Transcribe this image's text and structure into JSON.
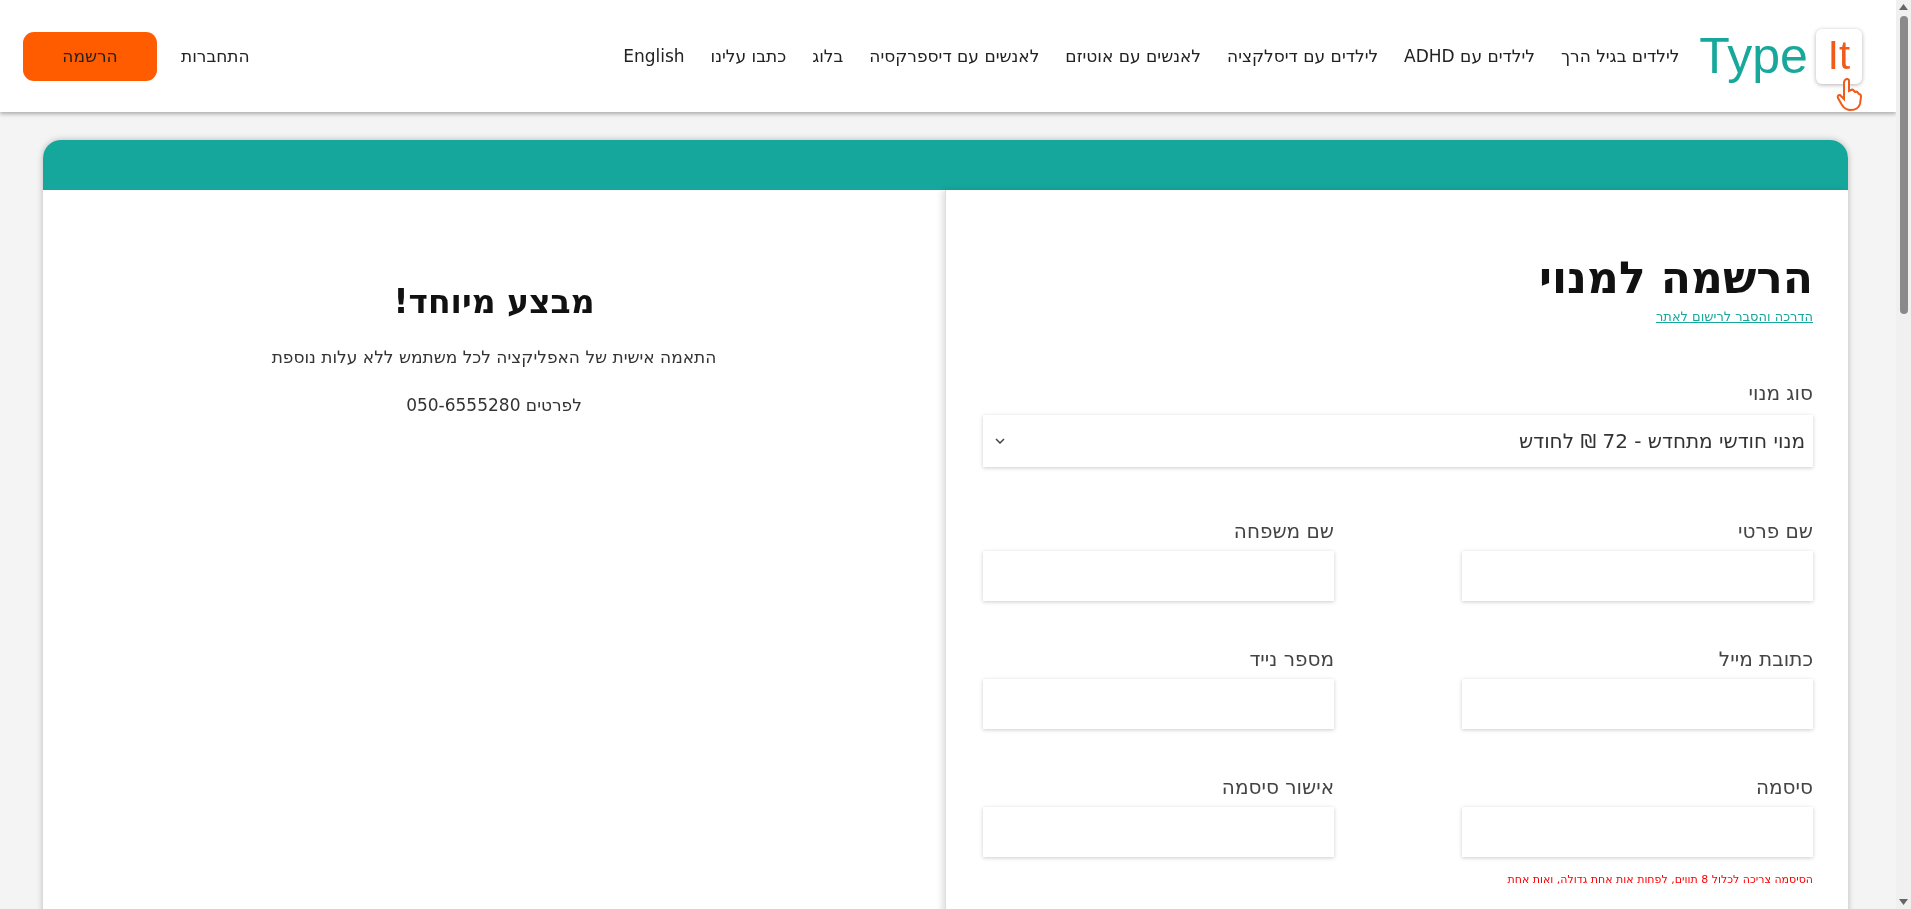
{
  "header": {
    "logo": {
      "word": "Type",
      "badge": "It"
    },
    "nav": [
      {
        "label": "לילדים בגיל הרך"
      },
      {
        "label": "לילדים עם ADHD"
      },
      {
        "label": "לילדים עם דיסלקציה"
      },
      {
        "label": "לאנשים עם אוטיזם"
      },
      {
        "label": "לאנשים עם דיספרקסיה"
      },
      {
        "label": "בלוג"
      },
      {
        "label": "כתבו עלינו"
      },
      {
        "label": "English"
      }
    ],
    "login": "התחברות",
    "signup": "הרשמה"
  },
  "form": {
    "title": "הרשמה למנוי",
    "guide_link": "הדרכה והסבר לרישום לאתר",
    "plan": {
      "label": "סוג מנוי",
      "value": "מנוי חודשי מתחדש - 72 ₪ לחודש"
    },
    "fields": [
      {
        "label": "שם פרטי"
      },
      {
        "label": "שם משפחה"
      },
      {
        "label": "כתובת מייל"
      },
      {
        "label": "מספר נייד"
      },
      {
        "label": "סיסמה"
      },
      {
        "label": "אישור סיסמה"
      }
    ],
    "password_hint": "הסיסמה צריכה לכלול 8 תווים, לפחות אות אחת גדולה, ואות אחת"
  },
  "offer": {
    "title": "מבצע מיוחד!",
    "text": "התאמה אישית של האפליקציה לכל משתמש ללא עלות נוספת",
    "contact": "לפרטים 050-6555280"
  }
}
